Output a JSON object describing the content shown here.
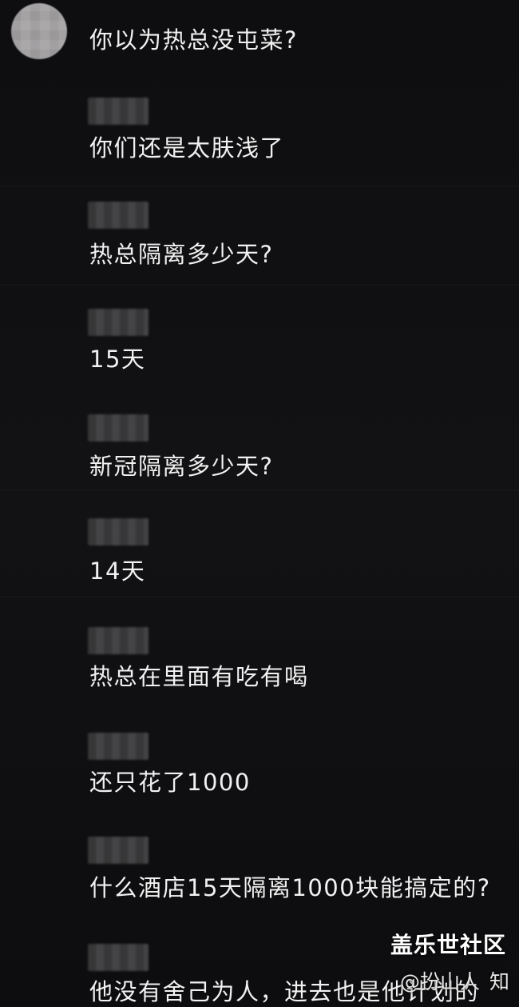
{
  "comments": [
    {
      "text": "你以为热总没屯菜?"
    },
    {
      "text": "你们还是太肤浅了"
    },
    {
      "text": "热总隔离多少天?"
    },
    {
      "text": "15天"
    },
    {
      "text": "新冠隔离多少天?"
    },
    {
      "text": "14天"
    },
    {
      "text": "热总在里面有吃有喝"
    },
    {
      "text": "还只花了1000"
    },
    {
      "text": "什么酒店15天隔离1000块能搞定的?"
    },
    {
      "text": "他没有舍己为人，进去也是他计划的"
    }
  ],
  "watermark": {
    "site": "盖乐世社区",
    "handle": "@扮山人",
    "overlay": "知"
  }
}
